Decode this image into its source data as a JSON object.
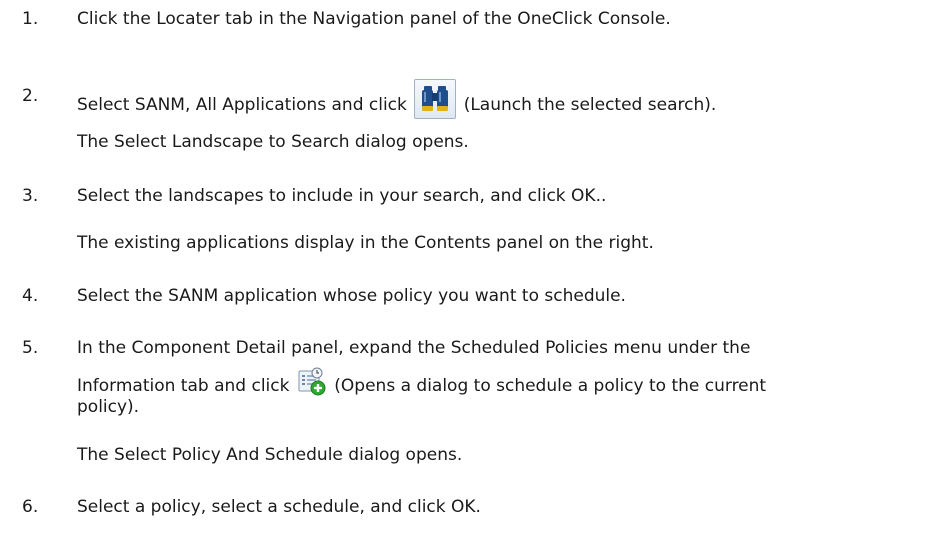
{
  "steps": [
    {
      "num": "1.",
      "text": "Click the Locater tab in the Navigation panel of the OneClick Console."
    },
    {
      "num": "2.",
      "before": "Select SANM, All Applications and click",
      "after": "(Launch the selected search).",
      "icon": "binoculars-icon",
      "note": "The Select Landscape to Search dialog opens."
    },
    {
      "num": "3.",
      "text": "Select the landscapes to include in your search, and click OK..",
      "note": "The existing applications display in the Contents panel on the right."
    },
    {
      "num": "4.",
      "text": "Select the SANM application whose policy you want to schedule."
    },
    {
      "num": "5.",
      "line1": "In the Component Detail panel, expand the Scheduled Policies menu under the",
      "before": "Information tab and click",
      "after": "(Opens a dialog to schedule a policy to the current",
      "line3": "policy).",
      "icon": "schedule-policy-add-icon",
      "note": "The Select Policy And Schedule dialog opens."
    },
    {
      "num": "6.",
      "text": "Select a policy, select a schedule, and click OK."
    }
  ],
  "colors": {
    "text": "#1a1a1a",
    "binoculars": "#1f4e8c",
    "add_badge": "#2fa82f"
  }
}
